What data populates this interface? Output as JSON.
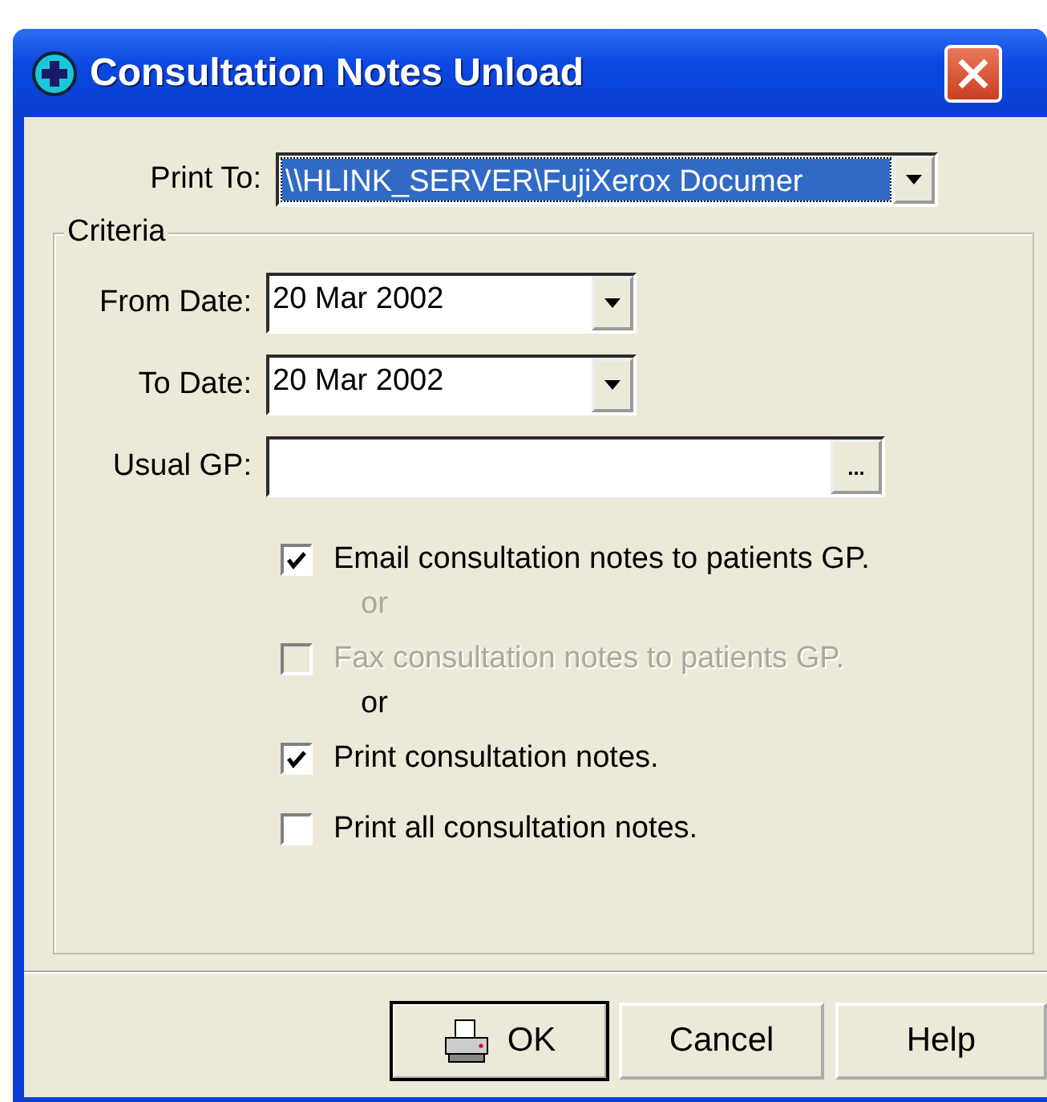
{
  "window": {
    "title": "Consultation Notes Unload"
  },
  "print_to": {
    "label": "Print To:",
    "value": "\\\\HLINK_SERVER\\FujiXerox Documer"
  },
  "criteria": {
    "title": "Criteria",
    "fields": [
      {
        "kind": "date",
        "label": "From Date:",
        "value": "20 Mar 2002"
      },
      {
        "kind": "date",
        "label": "To Date:",
        "value": "20 Mar 2002"
      },
      {
        "kind": "lookup",
        "label": "Usual GP:",
        "button": "..."
      }
    ],
    "options": [
      {
        "kind": "checkbox",
        "label": "Email consultation notes to patients GP.",
        "checked": true,
        "disabled": false
      },
      {
        "kind": "separator",
        "label": "or",
        "disabled": true
      },
      {
        "kind": "checkbox",
        "label": "Fax consultation notes to patients GP.",
        "checked": false,
        "disabled": true
      },
      {
        "kind": "separator",
        "label": "or",
        "disabled": false
      },
      {
        "kind": "checkbox",
        "label": "Print consultation notes.",
        "checked": true,
        "disabled": false
      },
      {
        "kind": "checkbox",
        "label": "Print all consultation notes.",
        "checked": false,
        "disabled": false
      }
    ]
  },
  "buttons": [
    {
      "label": "OK",
      "default": true
    },
    {
      "label": "Cancel",
      "default": false
    },
    {
      "label": "Help",
      "default": false
    }
  ]
}
